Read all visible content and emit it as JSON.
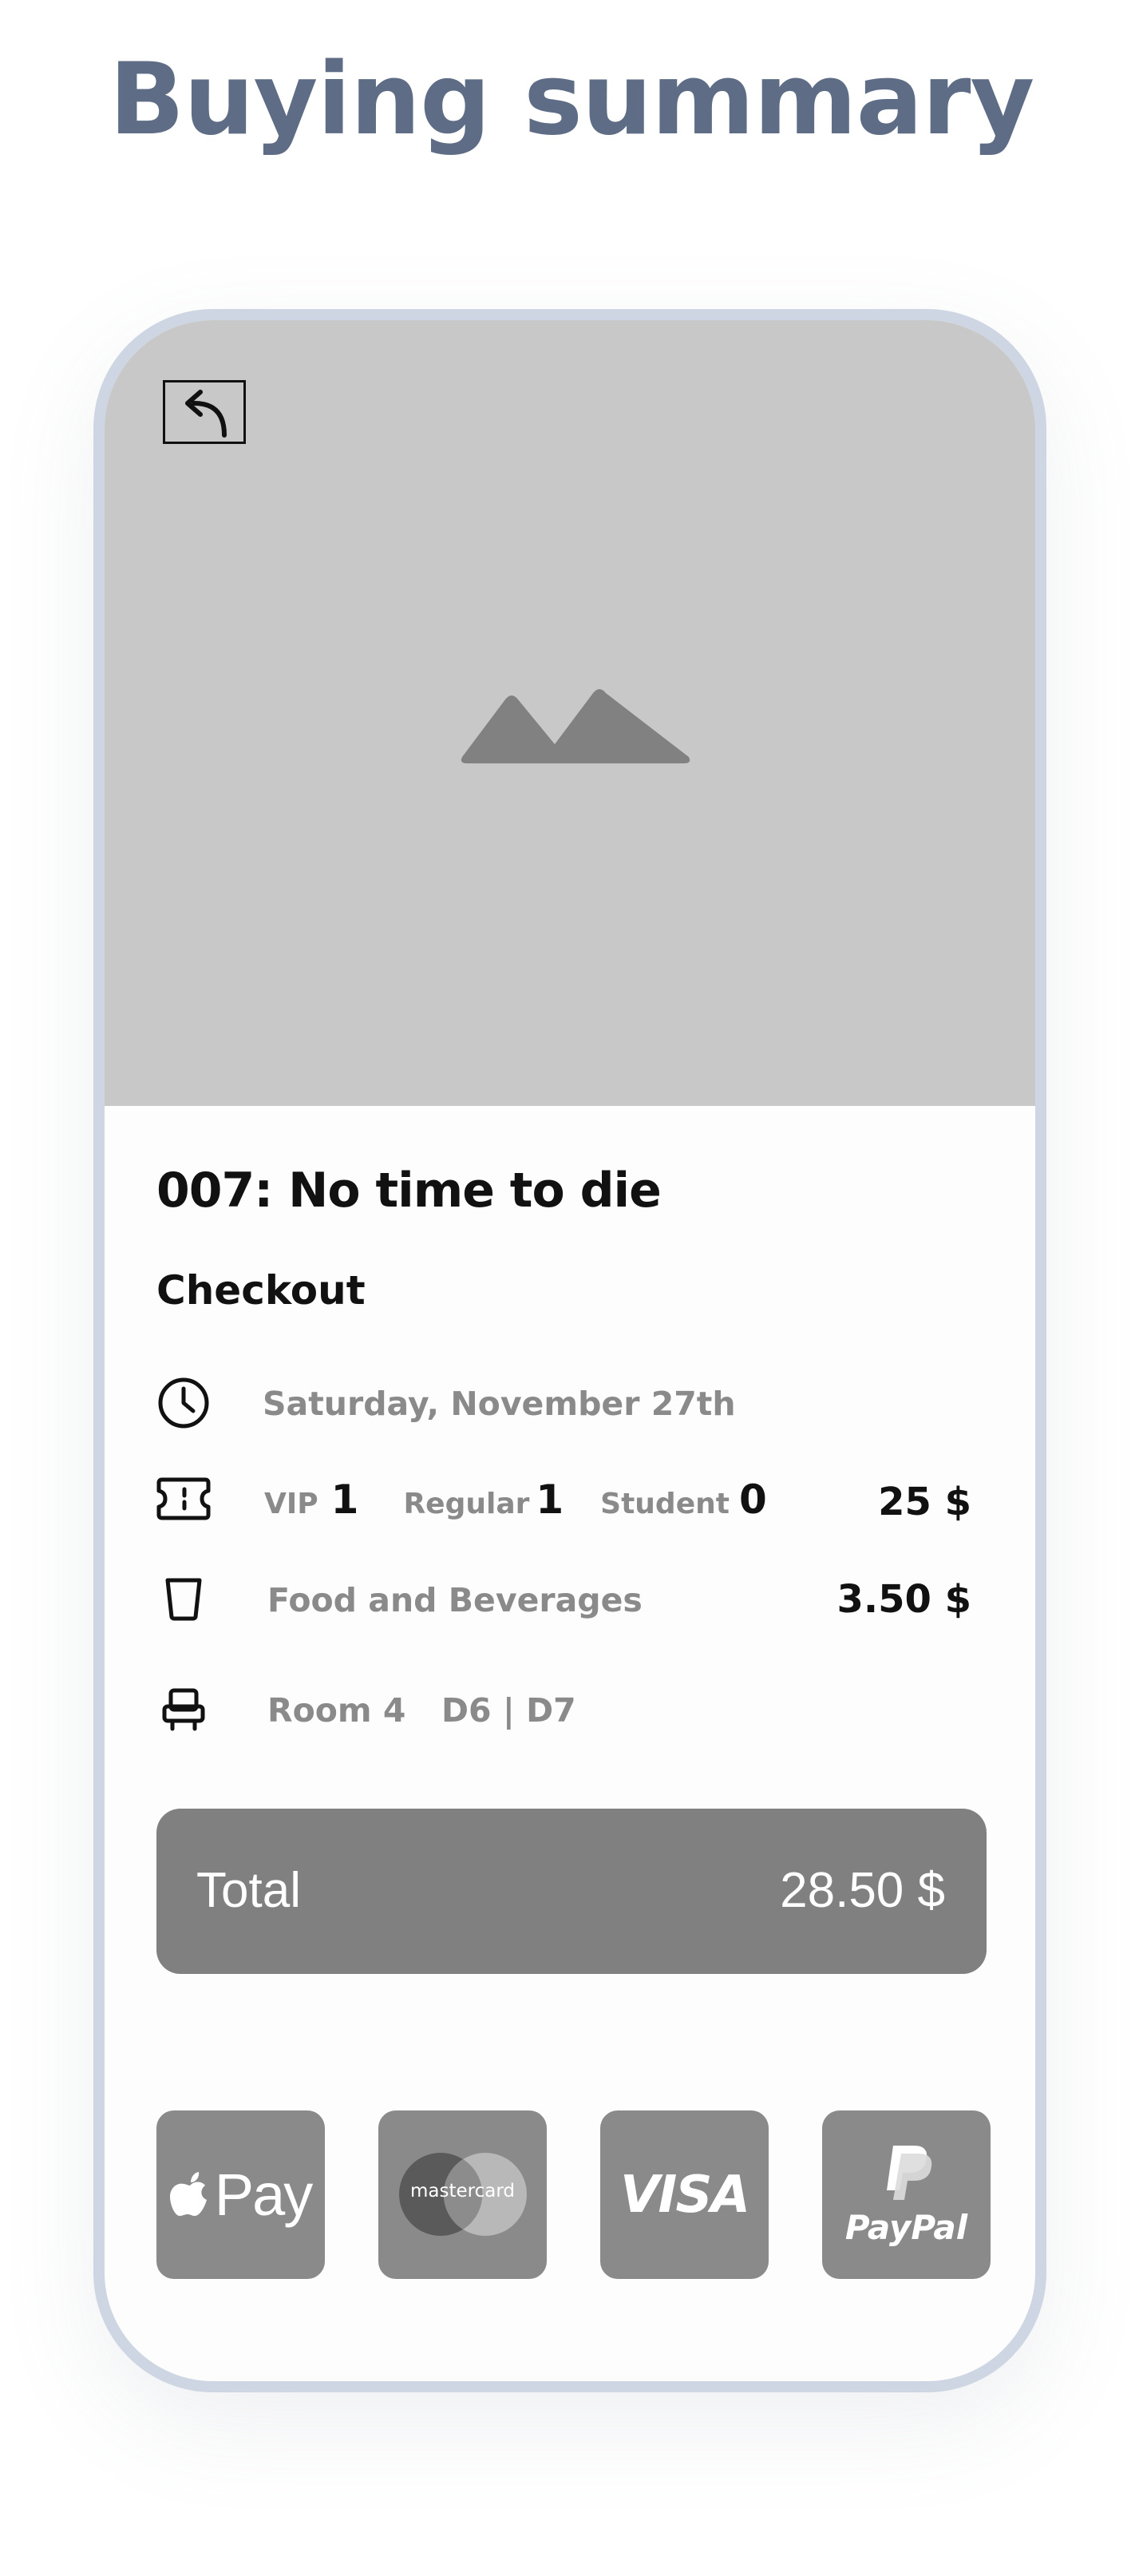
{
  "page": {
    "title": "Buying summary"
  },
  "movie": {
    "title": "007: No time to die",
    "section": "Checkout"
  },
  "summary": {
    "date": "Saturday, November 27th",
    "tickets": {
      "vip_label": "VIP",
      "vip_count": "1",
      "regular_label": "Regular",
      "regular_count": "1",
      "student_label": "Student",
      "student_count": "0",
      "price": "25 $"
    },
    "food": {
      "label": "Food and Beverages",
      "price": "3.50 $"
    },
    "room": {
      "label": "Room 4",
      "seats": "D6 | D7"
    }
  },
  "total": {
    "label": "Total",
    "value": "28.50 $"
  },
  "payment_methods": [
    {
      "id": "apple-pay",
      "label": "Pay"
    },
    {
      "id": "mastercard",
      "label": "mastercard"
    },
    {
      "id": "visa",
      "label": "VISA"
    },
    {
      "id": "paypal",
      "label": "PayPal"
    }
  ],
  "icons": {
    "back": "back-arrow-icon",
    "hero": "image-placeholder-icon",
    "date": "clock-icon",
    "tickets": "ticket-icon",
    "food": "cup-icon",
    "room": "seat-icon"
  },
  "colors": {
    "title": "#5e6d85",
    "phone_border": "#cdd6e2",
    "hero_bg": "#c8c8c8",
    "total_bg": "#808080",
    "payment_bg": "#8a8a8a",
    "muted_text": "#8a8a8a"
  }
}
